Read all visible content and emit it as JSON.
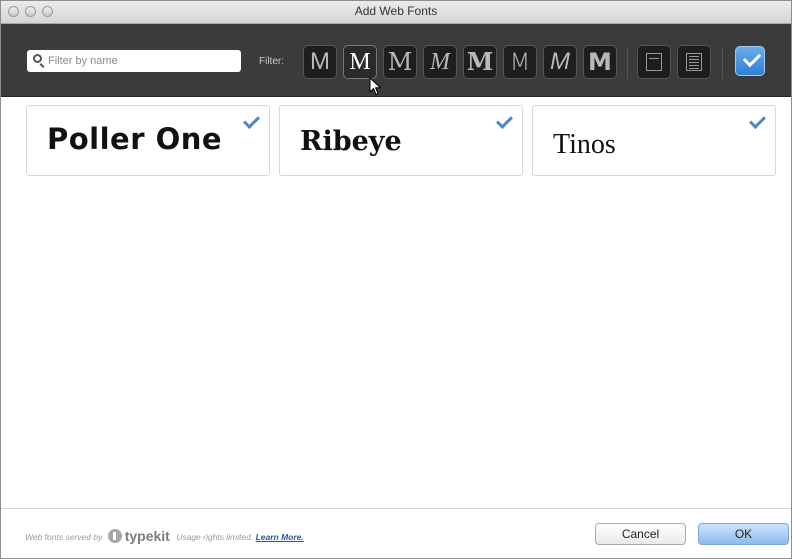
{
  "window": {
    "title": "Add Web Fonts"
  },
  "toolbar": {
    "search_placeholder": "Filter by name",
    "filter_label": "Filter:",
    "filter_glyph": "M",
    "filters": [
      {
        "name": "sans-serif",
        "font": "Liberation Sans"
      },
      {
        "name": "serif",
        "font": "Liberation Serif"
      },
      {
        "name": "slab-serif",
        "font": "DejaVu Serif"
      },
      {
        "name": "script",
        "font": "Liberation Serif"
      },
      {
        "name": "blackletter",
        "font": "DejaVu Serif"
      },
      {
        "name": "monospaced",
        "font": "DejaVu Sans"
      },
      {
        "name": "handwritten",
        "font": "Liberation Sans"
      },
      {
        "name": "decorative",
        "font": "DejaVu Sans"
      }
    ],
    "selected_filter": "serif",
    "accent_color": "#3d8ede"
  },
  "fonts": [
    {
      "name": "Poller One",
      "checked": true
    },
    {
      "name": "Ribeye",
      "checked": true
    },
    {
      "name": "Tinos",
      "checked": true
    }
  ],
  "footer": {
    "served_by": "Web fonts served by",
    "brand": "typekit",
    "usage": "Usage rights limited.",
    "learn_more": "Learn More.",
    "cancel_label": "Cancel",
    "ok_label": "OK"
  }
}
